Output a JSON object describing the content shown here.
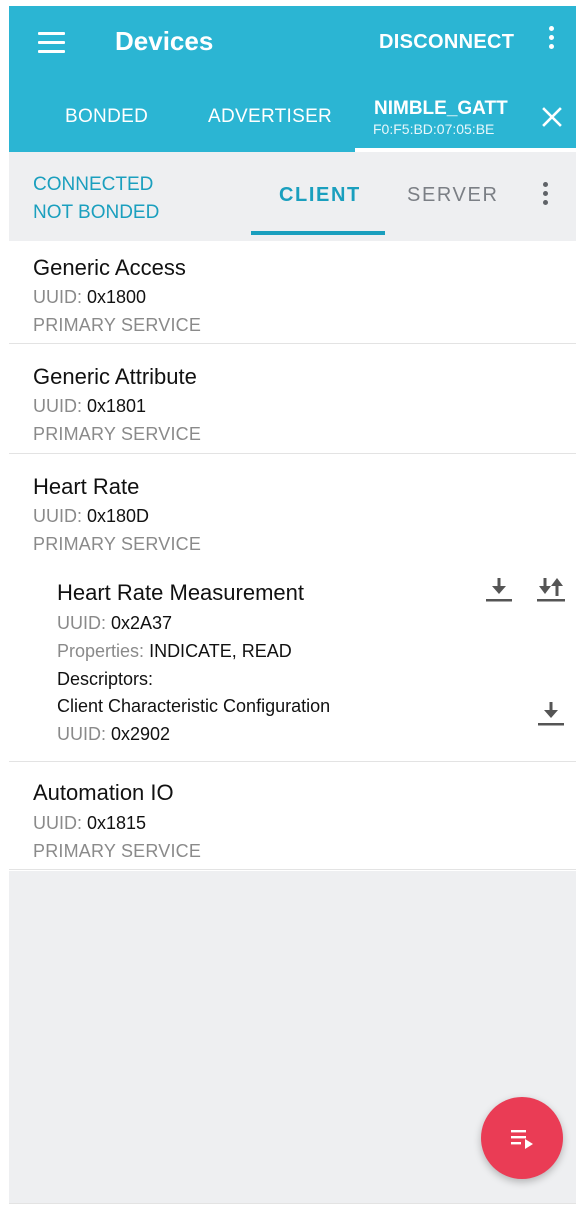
{
  "app_bar": {
    "title": "Devices",
    "disconnect_label": "DISCONNECT",
    "menu_icon": "hamburger-menu-icon",
    "overflow_icon": "more-vert-icon"
  },
  "tabs": [
    {
      "label": "BONDED"
    },
    {
      "label": "ADVERTISER"
    }
  ],
  "device_tab": {
    "name": "NIMBLE_GATT",
    "address": "F0:F5:BD:07:05:BE",
    "close_icon": "close-icon"
  },
  "connection": {
    "state": "CONNECTED",
    "bond_state": "NOT BONDED"
  },
  "sub_tabs": [
    {
      "label": "CLIENT",
      "selected": true
    },
    {
      "label": "SERVER",
      "selected": false
    }
  ],
  "uuid_label": "UUID:",
  "services": [
    {
      "name": "Generic Access",
      "uuid": "0x1800",
      "type": "PRIMARY SERVICE"
    },
    {
      "name": "Generic Attribute",
      "uuid": "0x1801",
      "type": "PRIMARY SERVICE"
    },
    {
      "name": "Heart Rate",
      "uuid": "0x180D",
      "type": "PRIMARY SERVICE",
      "characteristic": {
        "name": "Heart Rate Measurement",
        "uuid": "0x2A37",
        "properties_label": "Properties:",
        "properties": "INDICATE, READ",
        "descriptors_label": "Descriptors:",
        "descriptor": {
          "name": "Client Characteristic Configuration",
          "uuid": "0x2902"
        }
      }
    },
    {
      "name": "Automation IO",
      "uuid": "0x1815",
      "type": "PRIMARY SERVICE"
    }
  ],
  "colors": {
    "primary": "#2bb5d3",
    "accent_text": "#1a9fbe",
    "fab": "#ea3c55"
  }
}
